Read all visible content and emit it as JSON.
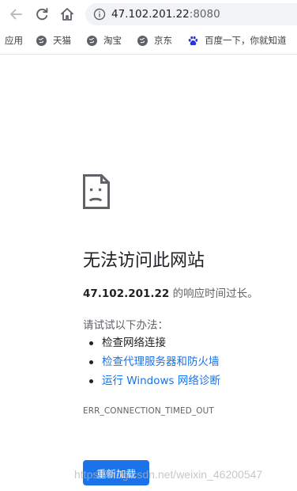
{
  "browser": {
    "url_host": "47.102.201.22",
    "url_port": ":8080"
  },
  "bookmarks": [
    {
      "label": "应用",
      "icon": "apps-icon"
    },
    {
      "label": "天猫",
      "icon": "globe-icon"
    },
    {
      "label": "淘宝",
      "icon": "globe-icon"
    },
    {
      "label": "京东",
      "icon": "globe-icon"
    },
    {
      "label": "百度一下，你就知道",
      "icon": "baidu-paw-icon"
    }
  ],
  "error_page": {
    "icon": "sad-page-icon",
    "title": "无法访问此网站",
    "host": "47.102.201.22",
    "desc_suffix": " 的响应时间过长。",
    "try_label": "请试试以下办法：",
    "suggestions": [
      {
        "text": "检查网络连接",
        "link": false
      },
      {
        "text": "检查代理服务器和防火墙",
        "link": true
      },
      {
        "text": "运行 Windows 网络诊断",
        "link": true
      }
    ],
    "error_code": "ERR_CONNECTION_TIMED_OUT",
    "reload_label": "重新加载"
  },
  "watermark": "https://blog.csdn.net/weixin_46200547",
  "colors": {
    "accent": "#1a73e8",
    "text": "#202124",
    "secondary": "#5f6368"
  }
}
